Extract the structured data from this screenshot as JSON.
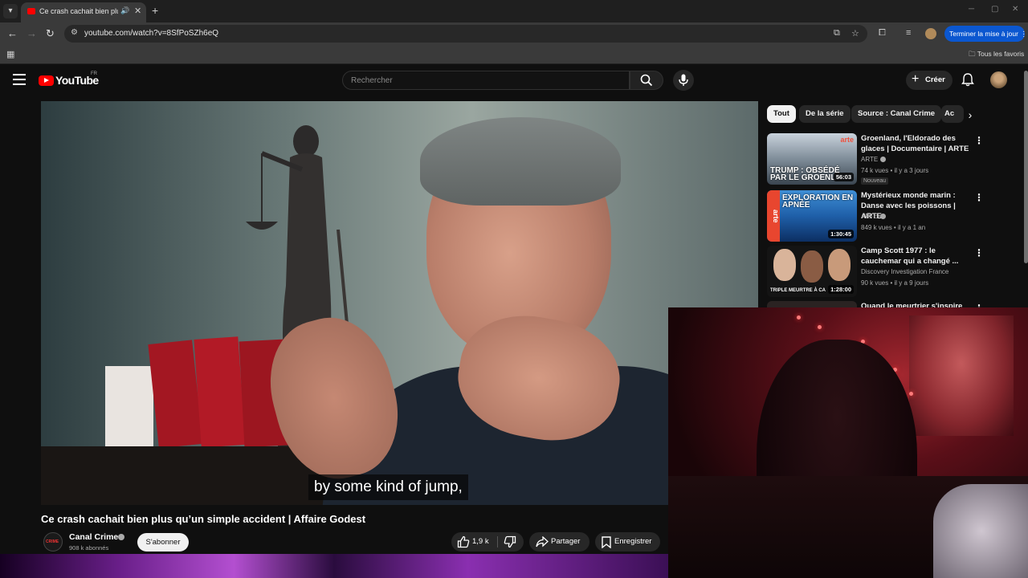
{
  "browser": {
    "tab_title": "Ce crash cachait bien plus qu'un simple accident | Affaire Godest",
    "url": "youtube.com/watch?v=8SfPoSZh6eQ",
    "update_button": "Terminer la mise à jour",
    "bookmarks_all": "Tous les favoris"
  },
  "youtube": {
    "logo_text": "YouTube",
    "region": "FR",
    "search_placeholder": "Rechercher",
    "create_label": "Créer"
  },
  "video": {
    "subtitle": "by some kind of jump,",
    "title": "Ce crash cachait bien plus qu’un simple accident | Affaire Godest",
    "channel": {
      "name": "Canal Crime",
      "subscribers": "908 k abonnés",
      "avatar_text": "CRIME",
      "subscribe_label": "S'abonner"
    },
    "actions": {
      "likes": "1,9 k",
      "share": "Partager",
      "save": "Enregistrer"
    }
  },
  "sidebar": {
    "chips": [
      "Tout",
      "De la série",
      "Source : Canal Crime",
      "Ac"
    ],
    "recommendations": [
      {
        "title": "Groenland, l'Eldorado des glaces | Documentaire | ARTE",
        "channel": "ARTE",
        "verified": true,
        "meta": "74 k vues • il y a 3 jours",
        "badge": "Nouveau",
        "duration": "56:03",
        "thumb_text": "TRUMP : OBSÉDÉ PAR LE GROENL",
        "thumb_brand": "arte"
      },
      {
        "title": "Mystérieux monde marin : Danse avec les poissons | ARTE",
        "channel": "ARTE",
        "verified": true,
        "meta": "849 k vues • il y a 1 an",
        "duration": "1:30:45",
        "thumb_text": "EXPLORATION EN APNÉE",
        "thumb_brand": "arte"
      },
      {
        "title": "Camp Scott 1977 : le cauchemar qui a changé ...",
        "channel": "Discovery Investigation France",
        "meta": "90 k vues • il y a 9 jours",
        "duration": "1:28:00",
        "thumb_text": "TRIPLE MEURTRE À CA"
      },
      {
        "title": "Quand le meurtrier s'inspire de"
      }
    ]
  },
  "colors": {
    "accent_red": "#ff0000",
    "update_blue": "#0b57d0",
    "page_bg": "#0f0f0f"
  }
}
